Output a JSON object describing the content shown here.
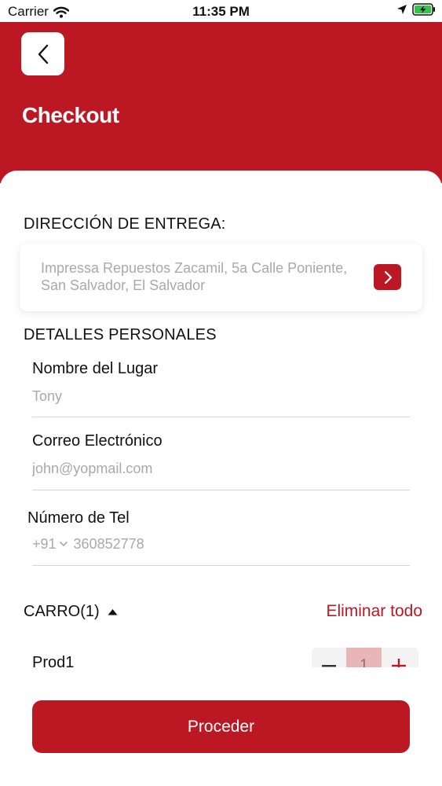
{
  "status_bar": {
    "carrier": "Carrier",
    "time": "11:35 PM",
    "icons": [
      "wifi-icon",
      "location-arrow-icon",
      "battery-charging-icon"
    ]
  },
  "header": {
    "back_icon": "chevron-left-icon",
    "title": "Checkout",
    "background_color": "#bc1823"
  },
  "delivery": {
    "section_title": "DIRECCIÓN DE ENTREGA:",
    "address": "Impressa Repuestos Zacamil, 5a Calle Poniente, San Salvador, El Salvador",
    "go_icon": "chevron-right-icon"
  },
  "personal": {
    "section_title": "DETALLES PERSONALES",
    "place_name": {
      "label": "Nombre del Lugar",
      "placeholder": "Tony",
      "value": ""
    },
    "email": {
      "label": "Correo Electrónico",
      "placeholder": "john@yopmail.com",
      "value": ""
    },
    "phone": {
      "label": "Número de Tel",
      "country_code": "+91",
      "placeholder": "360852778",
      "value": ""
    }
  },
  "cart": {
    "title": "CARRO(1)",
    "toggle_icon": "caret-up-icon",
    "clear_all": "Eliminar todo",
    "items": [
      {
        "name": "Prod1",
        "quantity": "1"
      }
    ]
  },
  "proceed_label": "Proceder",
  "colors": {
    "accent": "#bc1823",
    "placeholder": "#a9a9a9",
    "quantity_background": "#e8b5b9"
  }
}
